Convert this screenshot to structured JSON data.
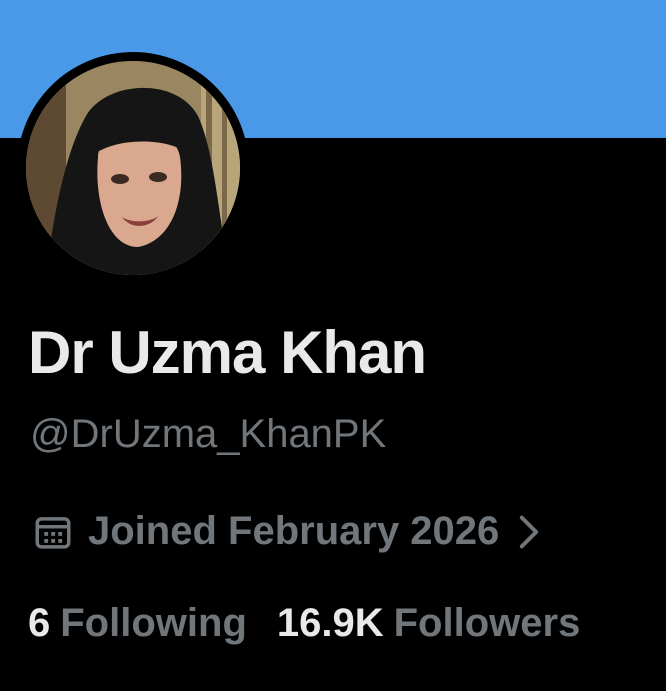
{
  "profile": {
    "display_name": "Dr Uzma Khan",
    "handle": "@DrUzma_KhanPK",
    "joined": "Joined February 2026",
    "avatar_description": "profile photo"
  },
  "stats": {
    "following_count": "6",
    "following_label": "Following",
    "followers_count": "16.9K",
    "followers_label": "Followers"
  },
  "icons": {
    "joined_icon": "calendar-icon",
    "joined_more": "chevron-right-icon"
  },
  "colors": {
    "banner": "#4a99e9",
    "background": "#000000",
    "primary_text": "#e7e9ea",
    "secondary_text": "#71767b"
  }
}
